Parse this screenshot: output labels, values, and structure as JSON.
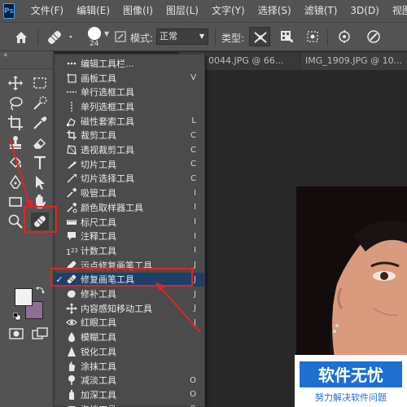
{
  "app": {
    "logo_text": "Ps"
  },
  "menubar": {
    "items": [
      "文件(F)",
      "编辑(E)",
      "图像(I)",
      "图层(L)",
      "文字(Y)",
      "选择(S)",
      "滤镜(T)",
      "3D(D)",
      "视图(V)"
    ]
  },
  "options": {
    "brush_size": "24",
    "mode_label": "模式:",
    "mode_value": "正常",
    "type_label": "类型:"
  },
  "tabs": [
    "0044.JPG @ 66...",
    "IMG_1909.JPG @ 10..."
  ],
  "panel": {
    "collapse_glyph": "«"
  },
  "flyout": {
    "items": [
      {
        "label": "编辑工具栏...",
        "key": "",
        "icon": "ellipsis-icon",
        "checked": false
      },
      {
        "label": "画板工具",
        "key": "V",
        "icon": "artboard-icon",
        "checked": false
      },
      {
        "label": "单行选框工具",
        "key": "",
        "icon": "single-row-marquee-icon",
        "checked": false
      },
      {
        "label": "单列选框工具",
        "key": "",
        "icon": "single-column-marquee-icon",
        "checked": false
      },
      {
        "label": "磁性套索工具",
        "key": "L",
        "icon": "magnetic-lasso-icon",
        "checked": false
      },
      {
        "label": "裁剪工具",
        "key": "C",
        "icon": "crop-icon",
        "checked": false
      },
      {
        "label": "透视裁剪工具",
        "key": "C",
        "icon": "perspective-crop-icon",
        "checked": false
      },
      {
        "label": "切片工具",
        "key": "C",
        "icon": "slice-icon",
        "checked": false
      },
      {
        "label": "切片选择工具",
        "key": "C",
        "icon": "slice-select-icon",
        "checked": false
      },
      {
        "label": "吸管工具",
        "key": "I",
        "icon": "eyedropper-icon",
        "checked": false
      },
      {
        "label": "颜色取样器工具",
        "key": "I",
        "icon": "color-sampler-icon",
        "checked": false
      },
      {
        "label": "标尺工具",
        "key": "I",
        "icon": "ruler-icon",
        "checked": false
      },
      {
        "label": "注释工具",
        "key": "I",
        "icon": "note-icon",
        "checked": false
      },
      {
        "label": "计数工具",
        "key": "I",
        "icon": "count-icon",
        "checked": false
      },
      {
        "label": "污点修复画笔工具",
        "key": "J",
        "icon": "spot-healing-icon",
        "checked": false
      },
      {
        "label": "修复画笔工具",
        "key": "J",
        "icon": "healing-brush-icon",
        "checked": true
      },
      {
        "label": "修补工具",
        "key": "J",
        "icon": "patch-icon",
        "checked": false
      },
      {
        "label": "内容感知移动工具",
        "key": "J",
        "icon": "content-aware-move-icon",
        "checked": false
      },
      {
        "label": "红眼工具",
        "key": "J",
        "icon": "red-eye-icon",
        "checked": false
      },
      {
        "label": "模糊工具",
        "key": "",
        "icon": "blur-icon",
        "checked": false
      },
      {
        "label": "锐化工具",
        "key": "",
        "icon": "sharpen-icon",
        "checked": false
      },
      {
        "label": "涂抹工具",
        "key": "",
        "icon": "smudge-icon",
        "checked": false
      },
      {
        "label": "减淡工具",
        "key": "O",
        "icon": "dodge-icon",
        "checked": false
      },
      {
        "label": "加深工具",
        "key": "O",
        "icon": "burn-icon",
        "checked": false
      },
      {
        "label": "海绵工具",
        "key": "O",
        "icon": "sponge-icon",
        "checked": false
      }
    ]
  },
  "watermark": {
    "title": "软件无忧",
    "subtitle": "努力解决软件问题"
  },
  "colors": {
    "foreground": "#f1f1f1",
    "background": "#8e6f96",
    "highlight": "#e02424",
    "selection": "#1f3f66"
  }
}
